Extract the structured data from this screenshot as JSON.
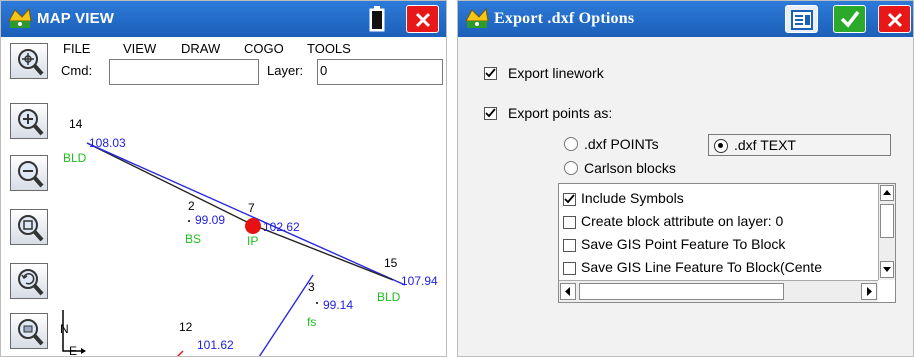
{
  "map_view": {
    "title": "MAP VIEW",
    "menu": [
      "FILE",
      "VIEW",
      "DRAW",
      "COGO",
      "TOOLS"
    ],
    "cmd_label": "Cmd:",
    "cmd_value": "",
    "layer_label": "Layer:",
    "layer_value": "0",
    "toolbar_icons": [
      "zoom-extents-icon",
      "zoom-in-icon",
      "zoom-out-icon",
      "zoom-window-icon",
      "zoom-previous-icon",
      "zoom-settings-icon"
    ],
    "points": [
      {
        "name": "14",
        "elev": "108.03",
        "desc": "BLD"
      },
      {
        "name": "2",
        "elev": "99.09",
        "desc": "BS"
      },
      {
        "name": "7",
        "elev": "102.62",
        "desc": "IP"
      },
      {
        "name": "15",
        "elev": "107.94",
        "desc": "BLD"
      },
      {
        "name": "3",
        "elev": "99.14",
        "desc": "fs"
      },
      {
        "name": "12",
        "elev": "101.62",
        "desc": ""
      }
    ],
    "north_label": "N",
    "east_label": "E"
  },
  "export_dialog": {
    "title": "Export .dxf Options",
    "export_linework": {
      "label": "Export linework",
      "checked": true
    },
    "export_points": {
      "label": "Export points as:",
      "checked": true
    },
    "radio_options": [
      {
        "label": ".dxf POINTs",
        "selected": false
      },
      {
        "label": ".dxf TEXT",
        "selected": true
      },
      {
        "label": "Carlson blocks",
        "selected": false
      }
    ],
    "list_items": [
      {
        "label": "Include Symbols",
        "checked": true
      },
      {
        "label": "Create block attribute on layer: 0",
        "checked": false
      },
      {
        "label": "Save GIS Point Feature To Block",
        "checked": false
      },
      {
        "label": "Save GIS Line Feature To Block(Cente",
        "checked": false
      }
    ]
  },
  "colors": {
    "titlebar": "#1c5fb8",
    "close_button": "#e81818",
    "ok_button": "#2ba92b",
    "line_blue": "#2a2ae0",
    "ip_marker": "#e81010",
    "desc_green": "#1fbf1f"
  }
}
